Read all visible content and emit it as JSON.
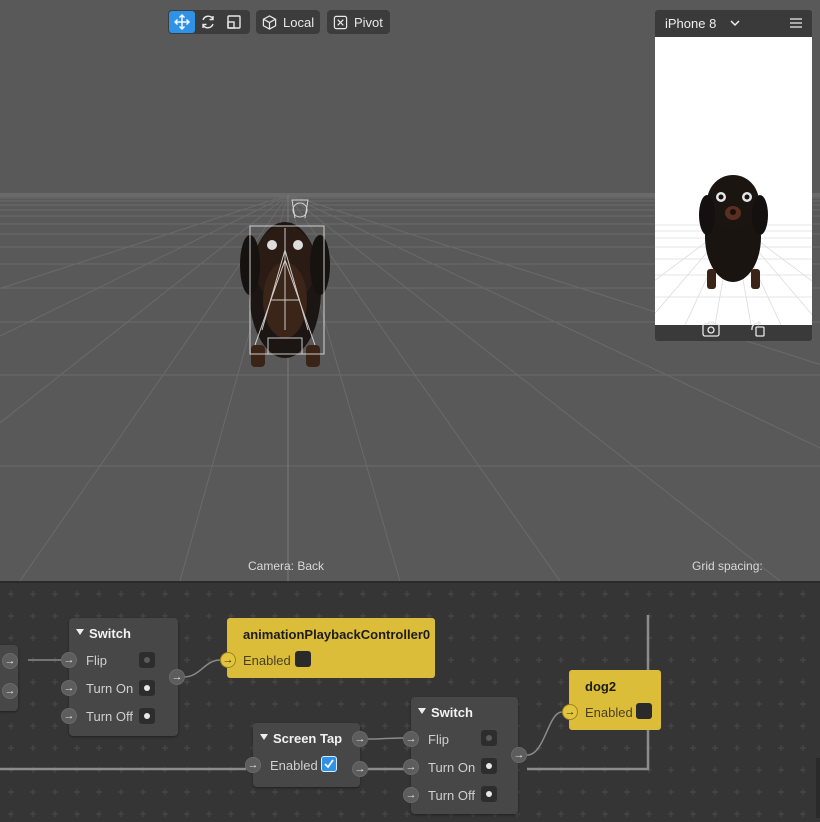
{
  "toolbar": {
    "transform_tools": [
      "move-icon",
      "rotate-icon",
      "scale-icon"
    ],
    "local_label": "Local",
    "pivot_label": "Pivot"
  },
  "viewport": {
    "camera_label": "Camera: Back",
    "grid_label": "Grid spacing:"
  },
  "preview": {
    "device": "iPhone 8"
  },
  "patches": {
    "switch1": {
      "title": "Switch",
      "ports": [
        "Flip",
        "Turn On",
        "Turn Off"
      ]
    },
    "anim": {
      "title": "animationPlaybackController0",
      "port": "Enabled"
    },
    "screen_tap": {
      "title": "Screen Tap",
      "port": "Enabled"
    },
    "switch2": {
      "title": "Switch",
      "ports": [
        "Flip",
        "Turn On",
        "Turn Off"
      ]
    },
    "dog2": {
      "title": "dog2",
      "port": "Enabled"
    }
  },
  "colors": {
    "accent": "#2e93e6",
    "patch_yellow": "#dcbd3a",
    "viewport_bg": "#595959",
    "patch_bg": "#353535"
  }
}
